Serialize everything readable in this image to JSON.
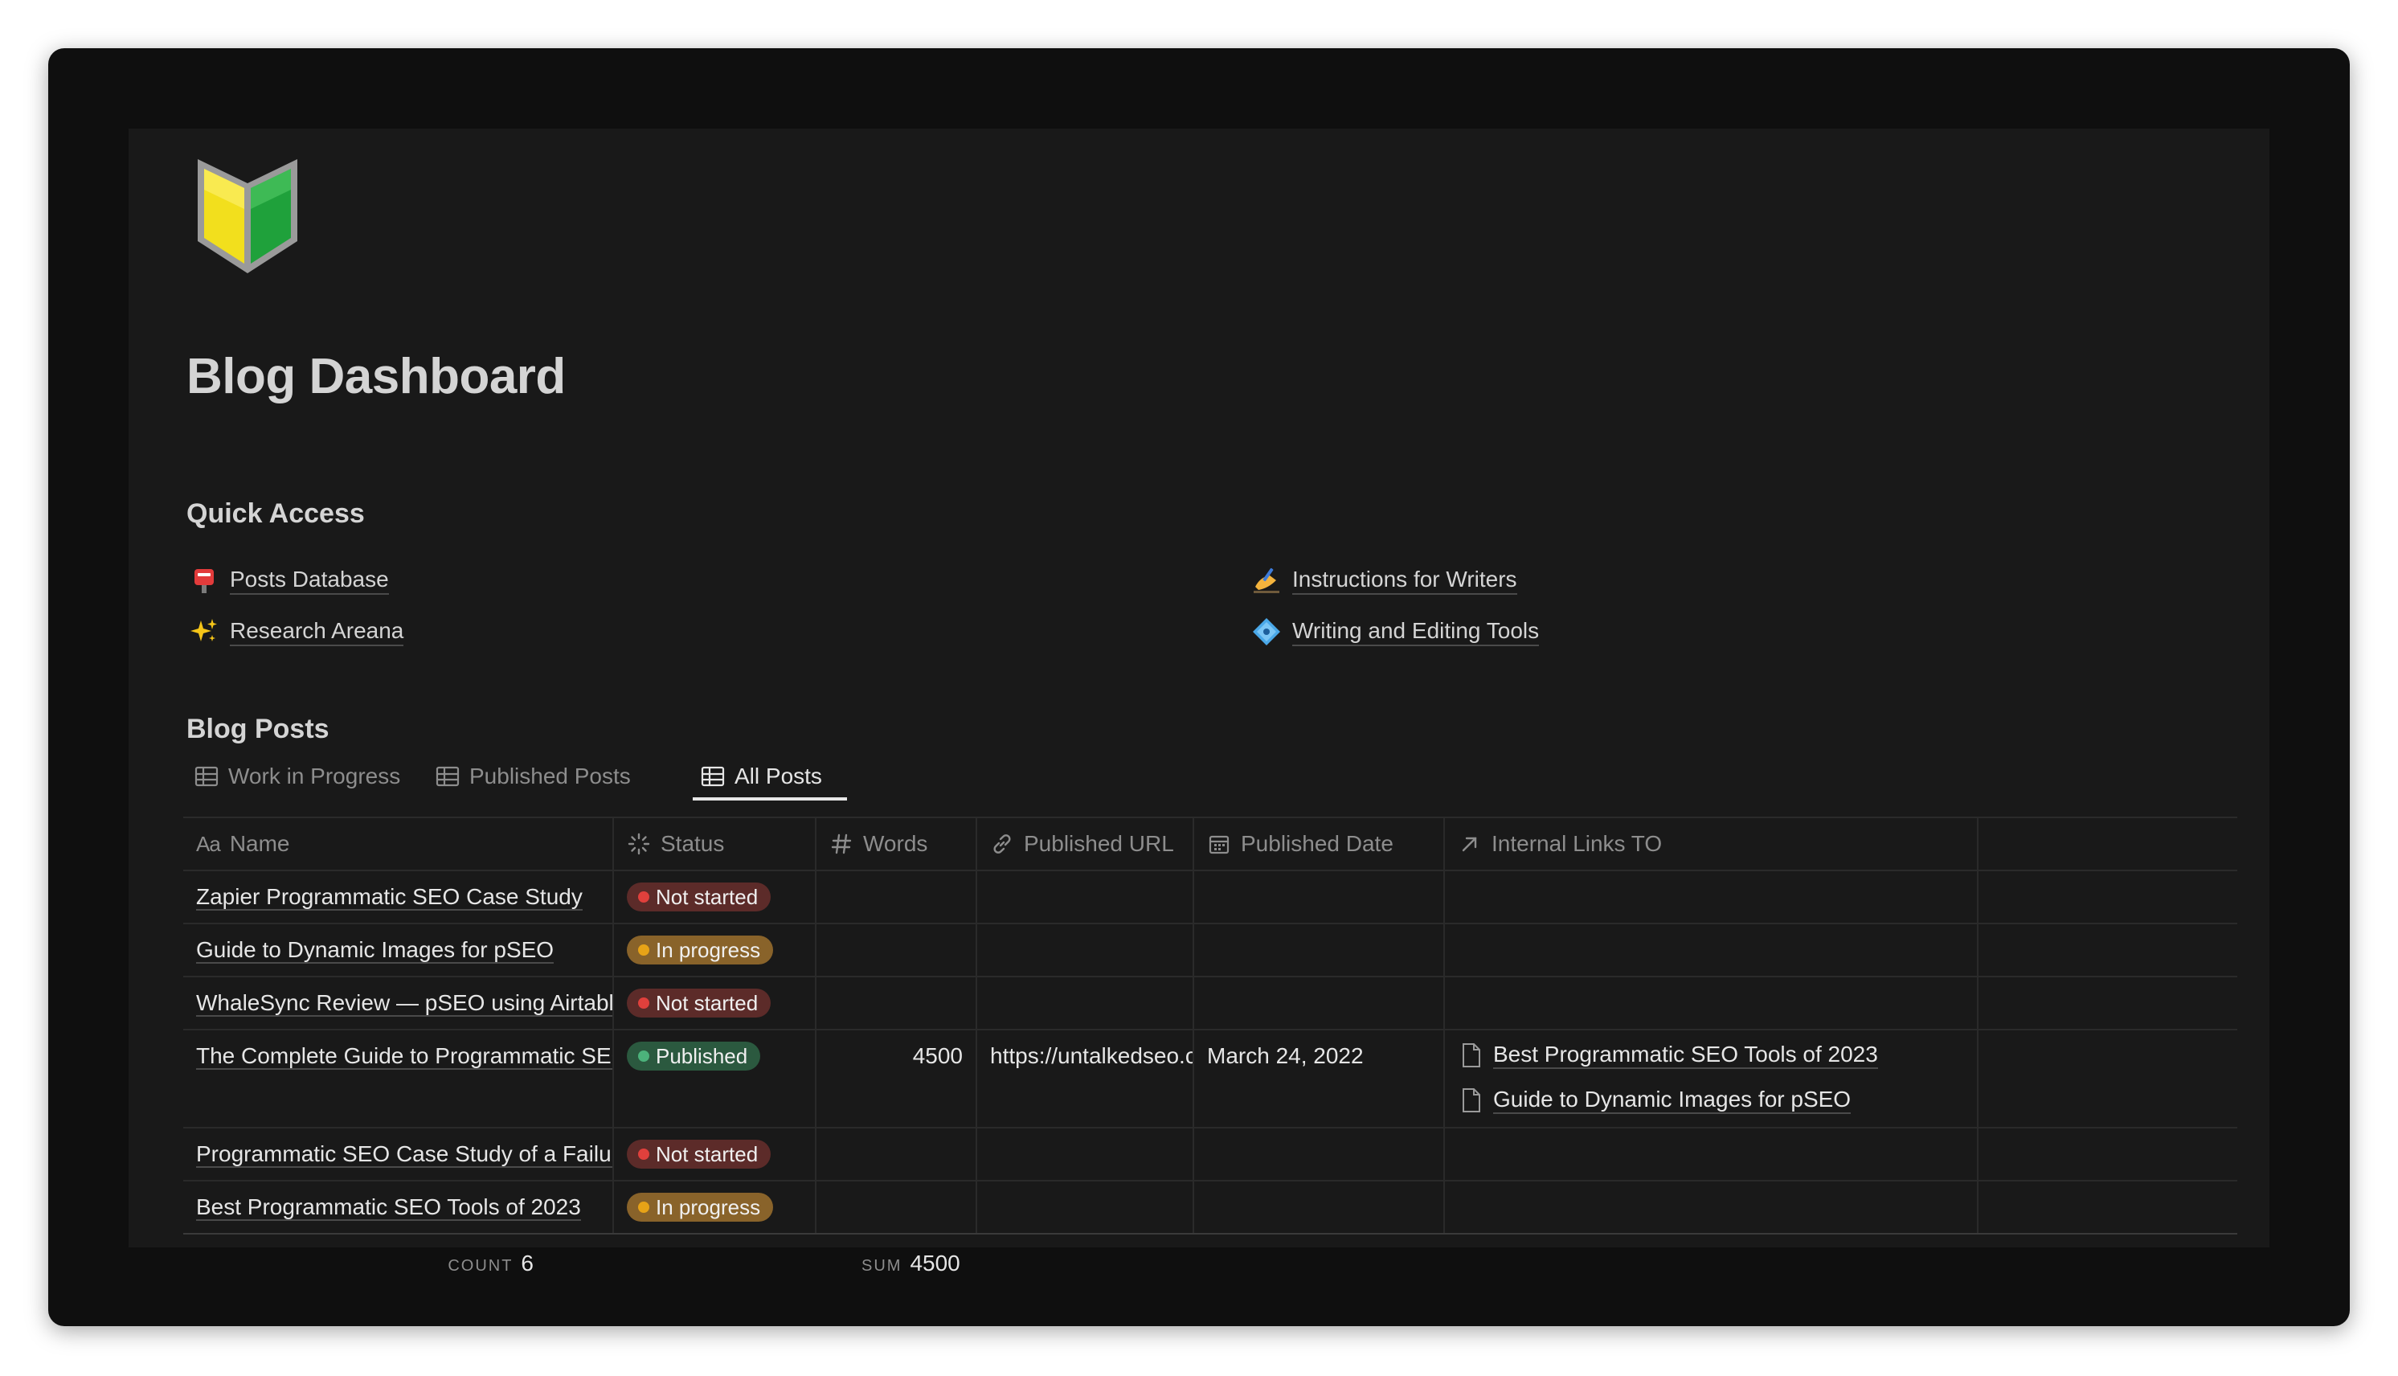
{
  "page": {
    "title": "Blog Dashboard",
    "icon": "beginner-shield-icon"
  },
  "quick_access": {
    "heading": "Quick Access",
    "links": [
      {
        "label": "Posts Database",
        "icon": "postbox-icon"
      },
      {
        "label": "Research Areana",
        "icon": "sparkles-icon"
      },
      {
        "label": "Instructions for Writers",
        "icon": "writing-hand-icon"
      },
      {
        "label": "Writing and Editing Tools",
        "icon": "diamond-dot-icon"
      }
    ]
  },
  "blog_posts": {
    "heading": "Blog Posts",
    "tabs": [
      {
        "label": "Work in Progress",
        "active": false
      },
      {
        "label": "Published Posts",
        "active": false
      },
      {
        "label": "All Posts",
        "active": true
      }
    ],
    "columns": {
      "name": "Name",
      "name_icon": "Aa",
      "status": "Status",
      "words": "Words",
      "url": "Published URL",
      "date": "Published Date",
      "links": "Internal Links TO"
    },
    "rows": [
      {
        "name": "Zapier Programmatic SEO Case Study",
        "status": "Not started",
        "words": "",
        "url": "",
        "date": "",
        "links": []
      },
      {
        "name": "Guide to Dynamic Images for pSEO",
        "status": "In progress",
        "words": "",
        "url": "",
        "date": "",
        "links": []
      },
      {
        "name": "WhaleSync Review — pSEO using Airtable",
        "status": "Not started",
        "words": "",
        "url": "",
        "date": "",
        "links": []
      },
      {
        "name": "The Complete Guide to Programmatic SEO",
        "status": "Published",
        "words": "4500",
        "url": "https://untalkedseo.com",
        "date": "March 24, 2022",
        "links": [
          "Best Programmatic SEO Tools of 2023",
          "Guide to Dynamic Images for pSEO"
        ]
      },
      {
        "name": "Programmatic SEO Case Study of a Failure",
        "status": "Not started",
        "words": "",
        "url": "",
        "date": "",
        "links": []
      },
      {
        "name": "Best Programmatic SEO Tools of 2023",
        "status": "In progress",
        "words": "",
        "url": "",
        "date": "",
        "links": []
      }
    ],
    "footer": {
      "count_label": "COUNT",
      "count_value": "6",
      "sum_label": "SUM",
      "sum_value": "4500"
    }
  },
  "status_colors": {
    "Not started": {
      "bg": "#5c2b29",
      "dot": "#e0403c"
    },
    "In progress": {
      "bg": "#89632a",
      "dot": "#e7a317"
    },
    "Published": {
      "bg": "#2b593f",
      "dot": "#4cb27b"
    }
  },
  "theme": {
    "window_bg": "#0f0f0f",
    "page_bg": "#191919",
    "text": "#d4d4d4",
    "muted": "#8d8d8d"
  }
}
